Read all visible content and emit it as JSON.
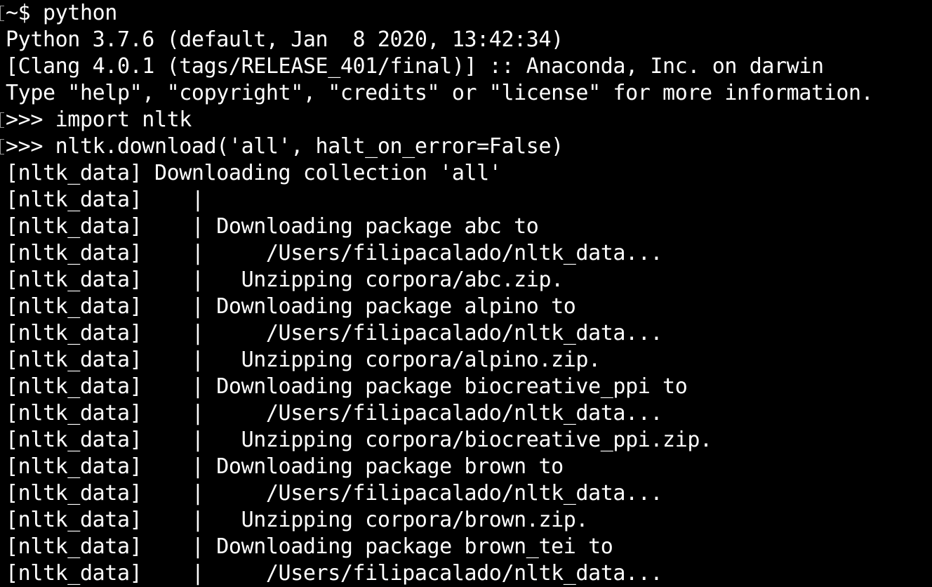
{
  "terminal": {
    "lines": [
      "~$ python",
      "Python 3.7.6 (default, Jan  8 2020, 13:42:34)",
      "[Clang 4.0.1 (tags/RELEASE_401/final)] :: Anaconda, Inc. on darwin",
      "Type \"help\", \"copyright\", \"credits\" or \"license\" for more information.",
      ">>> import nltk",
      ">>> nltk.download('all', halt_on_error=False)",
      "[nltk_data] Downloading collection 'all'",
      "[nltk_data]    |",
      "[nltk_data]    | Downloading package abc to",
      "[nltk_data]    |     /Users/filipacalado/nltk_data...",
      "[nltk_data]    |   Unzipping corpora/abc.zip.",
      "[nltk_data]    | Downloading package alpino to",
      "[nltk_data]    |     /Users/filipacalado/nltk_data...",
      "[nltk_data]    |   Unzipping corpora/alpino.zip.",
      "[nltk_data]    | Downloading package biocreative_ppi to",
      "[nltk_data]    |     /Users/filipacalado/nltk_data...",
      "[nltk_data]    |   Unzipping corpora/biocreative_ppi.zip.",
      "[nltk_data]    | Downloading package brown to",
      "[nltk_data]    |     /Users/filipacalado/nltk_data...",
      "[nltk_data]    |   Unzipping corpora/brown.zip.",
      "[nltk_data]    | Downloading package brown_tei to",
      "[nltk_data]    |     /Users/filipacalado/nltk_data..."
    ],
    "colors": {
      "background": "#000000",
      "foreground": "#ffffff",
      "mark": "#9a9a9a"
    }
  }
}
